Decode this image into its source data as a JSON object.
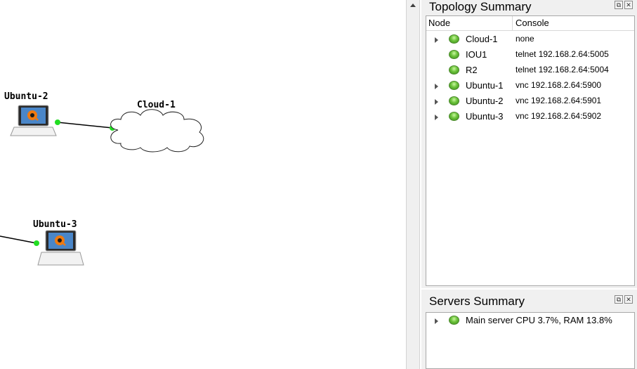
{
  "canvas": {
    "nodes": [
      {
        "name": "Ubuntu-2",
        "type": "qemu-vm",
        "icon": "laptop-qemu-icon"
      },
      {
        "name": "Cloud-1",
        "type": "cloud",
        "icon": "cloud-icon"
      },
      {
        "name": "Ubuntu-3",
        "type": "qemu-vm",
        "icon": "laptop-qemu-icon"
      }
    ],
    "link_status_color": "#22dd22"
  },
  "topology_summary": {
    "title": "Topology Summary",
    "columns": [
      "Node",
      "Console"
    ],
    "rows": [
      {
        "node": "Cloud-1",
        "console": "none",
        "expandable": true,
        "status": "started"
      },
      {
        "node": "IOU1",
        "console": "telnet 192.168.2.64:5005",
        "expandable": false,
        "status": "started"
      },
      {
        "node": "R2",
        "console": "telnet 192.168.2.64:5004",
        "expandable": false,
        "status": "started"
      },
      {
        "node": "Ubuntu-1",
        "console": "vnc 192.168.2.64:5900",
        "expandable": true,
        "status": "started"
      },
      {
        "node": "Ubuntu-2",
        "console": "vnc 192.168.2.64:5901",
        "expandable": true,
        "status": "started"
      },
      {
        "node": "Ubuntu-3",
        "console": "vnc 192.168.2.64:5902",
        "expandable": true,
        "status": "started"
      }
    ]
  },
  "servers_summary": {
    "title": "Servers Summary",
    "rows": [
      {
        "text": "Main server CPU 3.7%, RAM 13.8%",
        "expandable": true,
        "status": "started"
      }
    ]
  },
  "dock_buttons": {
    "float": "⧉",
    "close": "✕"
  },
  "colors": {
    "status_green": "#6bc23a",
    "panel_bg": "#f0f0f0"
  }
}
